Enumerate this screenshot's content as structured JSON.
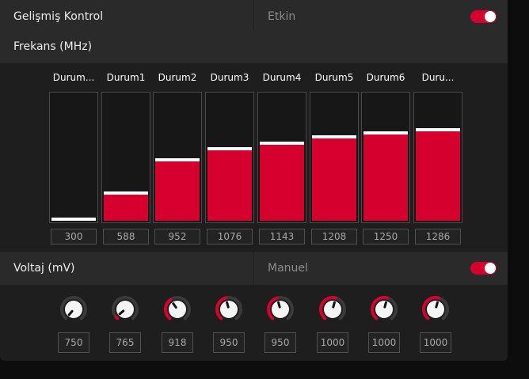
{
  "advanced": {
    "label": "Gelişmiş Kontrol",
    "status": "Etkin",
    "toggle_on": true
  },
  "frequency": {
    "title": "Frekans (MHz)",
    "states": [
      {
        "label": "Durum...",
        "value": "300"
      },
      {
        "label": "Durum1",
        "value": "588"
      },
      {
        "label": "Durum2",
        "value": "952"
      },
      {
        "label": "Durum3",
        "value": "1076"
      },
      {
        "label": "Durum4",
        "value": "1143"
      },
      {
        "label": "Durum5",
        "value": "1208"
      },
      {
        "label": "Durum6",
        "value": "1250"
      },
      {
        "label": "Duru...",
        "value": "1286"
      }
    ],
    "min": 300,
    "max": 1700
  },
  "voltage": {
    "title": "Voltaj (mV)",
    "mode": "Manuel",
    "toggle_on": true,
    "values": [
      "750",
      "765",
      "918",
      "950",
      "950",
      "1000",
      "1000",
      "1000"
    ],
    "min": 750,
    "max": 1200
  },
  "colors": {
    "accent": "#d6002f",
    "panel": "#1e1e1e",
    "row": "#2a2a2a"
  }
}
